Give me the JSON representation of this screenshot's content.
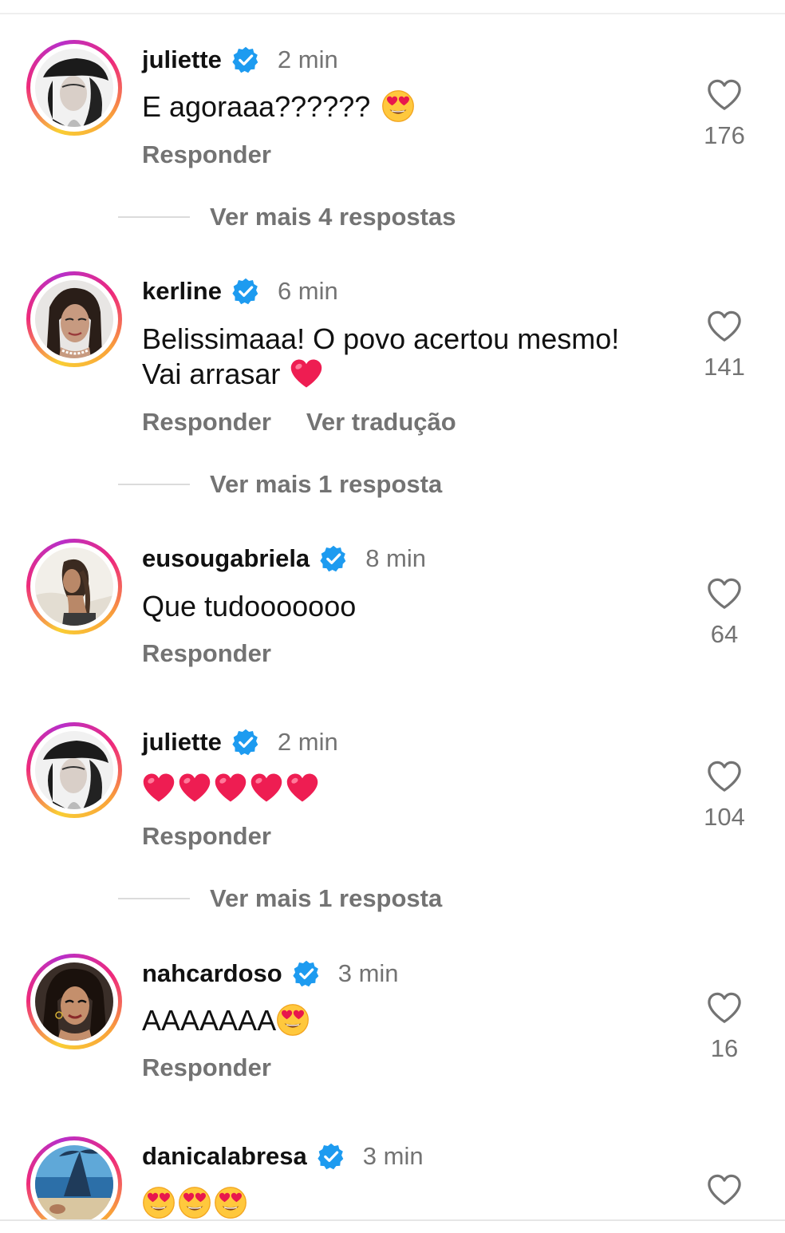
{
  "comments": [
    {
      "username": "juliette",
      "time": "2 min",
      "text": "E agoraaa??????",
      "emojis": [
        "heart-eyes"
      ],
      "actions": [
        "Responder"
      ],
      "likes": "176",
      "more_replies": "Ver mais 4 respostas"
    },
    {
      "username": "kerline",
      "time": "6 min",
      "text_line1": "Belissimaaa! O povo acertou mesmo!",
      "text_line2": "Vai arrasar",
      "emojis": [
        "red-heart"
      ],
      "actions": [
        "Responder",
        "Ver tradução"
      ],
      "likes": "141",
      "more_replies": "Ver mais 1 resposta"
    },
    {
      "username": "eusougabriela",
      "time": "8 min",
      "text": "Que tudooooooo",
      "actions": [
        "Responder"
      ],
      "likes": "64"
    },
    {
      "username": "juliette",
      "time": "2 min",
      "emojis": [
        "red-heart",
        "red-heart",
        "red-heart",
        "red-heart",
        "red-heart"
      ],
      "actions": [
        "Responder"
      ],
      "likes": "104",
      "more_replies": "Ver mais 1 resposta"
    },
    {
      "username": "nahcardoso",
      "time": "3 min",
      "text": "AAAAAAA",
      "emojis": [
        "heart-eyes"
      ],
      "actions": [
        "Responder"
      ],
      "likes": "16"
    },
    {
      "username": "danicalabresa",
      "time": "3 min",
      "emojis": [
        "heart-eyes",
        "heart-eyes",
        "heart-eyes"
      ]
    }
  ],
  "colors": {
    "text": "#111111",
    "secondary": "#737373",
    "verified": "#1d9bf0",
    "emoji_heart": "#e8174d",
    "emoji_face": "#ffc83d"
  }
}
